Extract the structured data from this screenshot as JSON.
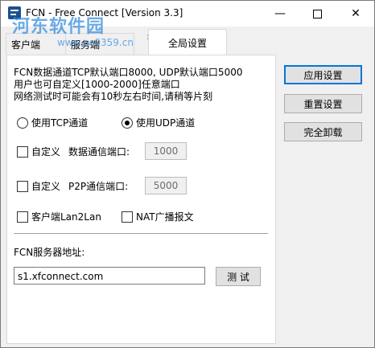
{
  "window": {
    "title": "FCN - Free Connect [Version 3.3]",
    "watermark": "河东软件园",
    "watermark_url": "www.pc0359.cn"
  },
  "tabs": [
    {
      "label": "客户端"
    },
    {
      "label": "服务端"
    },
    {
      "label": "全局设置"
    }
  ],
  "info": {
    "line1": "FCN数据通道TCP默认端口8000, UDP默认端口5000",
    "line2": "用户也可自定义[1000-2000]任意端口",
    "line3": "网络测试时可能会有10秒左右时间,请稍等片刻"
  },
  "channel": {
    "tcp_label": "使用TCP通道",
    "udp_label": "使用UDP通道",
    "selected": "udp"
  },
  "custom_data_port": {
    "checkbox_label": "自定义",
    "field_label": "数据通信端口:",
    "value": "1000"
  },
  "custom_p2p_port": {
    "checkbox_label": "自定义",
    "field_label": "P2P通信端口:",
    "value": "5000"
  },
  "options": {
    "lan2lan_label": "客户端Lan2Lan",
    "nat_label": "NAT广播报文"
  },
  "server": {
    "label": "FCN服务器地址:",
    "value": "s1.xfconnect.com",
    "test_label": "测 试"
  },
  "side_buttons": {
    "apply": "应用设置",
    "reset": "重置设置",
    "uninstall": "完全卸载"
  }
}
